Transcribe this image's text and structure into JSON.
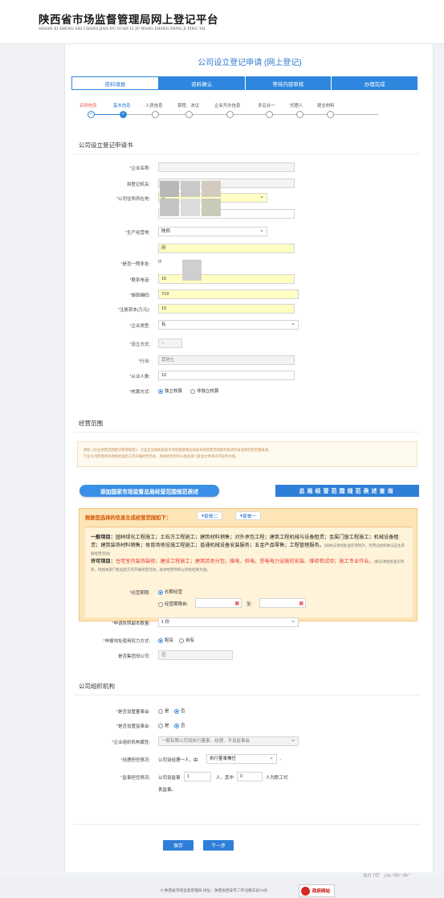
{
  "header": {
    "title_cn": "陕西省市场监督管理局网上登记平台",
    "title_en": "SHAAN XI SHENG SHI CHANG JIAN DU GUAN LI JU WANG SHANG DENG JI PING TAI"
  },
  "page_title": "公司设立登记申请 (网上登记)",
  "steps": [
    "资料填报",
    "资料确认",
    "等待内容审核",
    "办理完成"
  ],
  "substeps": [
    "名称信息",
    "基本信息",
    "人员信息",
    "章程、决议",
    "企业开办信息",
    "多证合一",
    "代理人",
    "提交材料"
  ],
  "section_application": "公司设立登记申请书",
  "form": {
    "company_name": {
      "label": "企业名称:",
      "value": ""
    },
    "registration_authority": {
      "label": "拟登记机关:",
      "value": ""
    },
    "residence": {
      "label": "公司住所所在地:",
      "select_value": "总",
      "detail_value": "府元"
    },
    "business_location": {
      "label": "生产经营地:",
      "select_value": "陕西",
      "detail_value": "府"
    },
    "multi_address": {
      "label": "是否一照多址:",
      "value": "O"
    },
    "phone": {
      "label": "联系电话:",
      "value": "15"
    },
    "postal_code": {
      "label": "邮政编码:",
      "value": "719"
    },
    "registered_capital": {
      "label": "注册资本(万元):",
      "value": "10"
    },
    "enterprise_type": {
      "label": "企业类型:",
      "value": "有"
    },
    "establishment_method": {
      "label": "设立方式:",
      "value": "--"
    },
    "industry": {
      "label": "行业:",
      "value": "其他土"
    },
    "employees": {
      "label": "从业人数:",
      "value": "10"
    },
    "accounting_method": {
      "label": "核算方式:",
      "options": [
        "独立核算",
        "非独立核算"
      ],
      "selected": "独立核算"
    }
  },
  "section_scope": "经营范围",
  "notice_lines": [
    "依照《企业经营范围登记管理规定》，企业应当依照国家市场监督管理总局发布的经营范围规范表述目录选择经营范围表述。",
    "行业许可经营项目须经批准后方可开展经营活动，具体经营项目以相关部门批准文件或许可证件为准。"
  ],
  "buttons": {
    "add_scope": "添加国家市场监督总局经营范围规范表述",
    "query_scope": "总局经营范围规范表述查询",
    "save": "保存",
    "next": "下一步"
  },
  "scope_box": {
    "head": "根据您选择的信息生成经营范围如下：",
    "pkg1": "套餐二",
    "pkg2": "套餐一",
    "general_label": "一般项目：",
    "general_text": "园林绿化工程施工；土石方工程施工；建筑材料销售；对外承包工程；建筑工程机械与设备租赁；金属门窗工程施工；机械设备租赁；建筑装饰材料销售；体育场地设施工程施工；普通机械设备安装服务；五金产品零售；工程管理服务。",
    "general_note": "(除依法须经批准的项目外，凭营业执照依法自主开展经营活动)",
    "license_label": "许可项目：",
    "license_text": "住宅室内装饰装修；建设工程施工；建筑劳务分包；输电、供电、受电电力设施的安装、维修和试验；施工专业作业。",
    "license_note": "(依法须经批准的项目，经相关部门批准后方可开展经营活动，具体经营项目以审批结果为准)"
  },
  "operation": {
    "term_label": "经营期限:",
    "term_long": "长期经营",
    "term_until": "经营期限自:",
    "to": "至:",
    "copies_label": "申请执照副本数量:",
    "copies_value": "1 份",
    "right_label": "申报地址使用权力方式:",
    "right_options": [
      "租赁",
      "自有"
    ],
    "right_selected": "租赁",
    "group_label": "是否集团母公司:",
    "group_value": "否"
  },
  "section_org": "公司组织机构",
  "org": {
    "board_label": "是否设置董事会:",
    "supervisor_label": "是否设置监事会:",
    "yes": "是",
    "no": "否",
    "attr_label": "企业组织机构属性:",
    "attr_value": "一般有限公司设执行董事、经理、不设监事会",
    "manager_label": "经理担任情况:",
    "manager_prefix": "公司设经理一人，由",
    "manager_value": "执行董事兼任",
    "supervisor_count_label": "监事担任情况:",
    "supervisor_prefix": "公司设监事",
    "supervisor_count": "1",
    "supervisor_mid": "人，其中",
    "supervisor_staff": "0",
    "supervisor_suffix": "人为职工代",
    "supervisor_suffix2": "表监事。"
  },
  "footer": {
    "text": "© 陕西省市场监督管理局 地址：陕西省西安市二环北路东段73号",
    "badge": "政府网站",
    "watermark": "知乎 @言言"
  }
}
